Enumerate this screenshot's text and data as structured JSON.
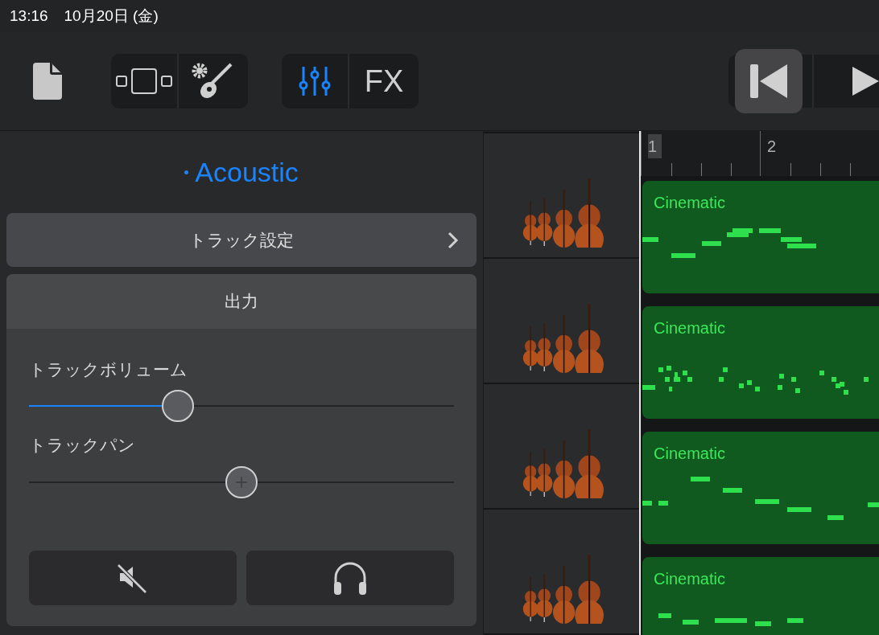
{
  "status_bar": {
    "time": "13:16",
    "date": "10月20日 (金)"
  },
  "toolbar": {
    "fx_label": "FX",
    "mixer_selected": true,
    "rewind_pressed": true
  },
  "panel": {
    "track_name": "Acoustic",
    "track_settings": "トラック設定",
    "output": {
      "title": "出力",
      "sliders": [
        {
          "kind": "volume",
          "label": "トラックボリューム",
          "level": 0.35
        },
        {
          "kind": "pan",
          "label": "トラックパン",
          "level": 0.5
        }
      ]
    }
  },
  "ruler": {
    "markers": [
      "1",
      "2"
    ]
  },
  "tracks": [
    {
      "region": "Cinematic"
    },
    {
      "region": "Cinematic"
    },
    {
      "region": "Cinematic"
    },
    {
      "region": "Cinematic"
    }
  ]
}
